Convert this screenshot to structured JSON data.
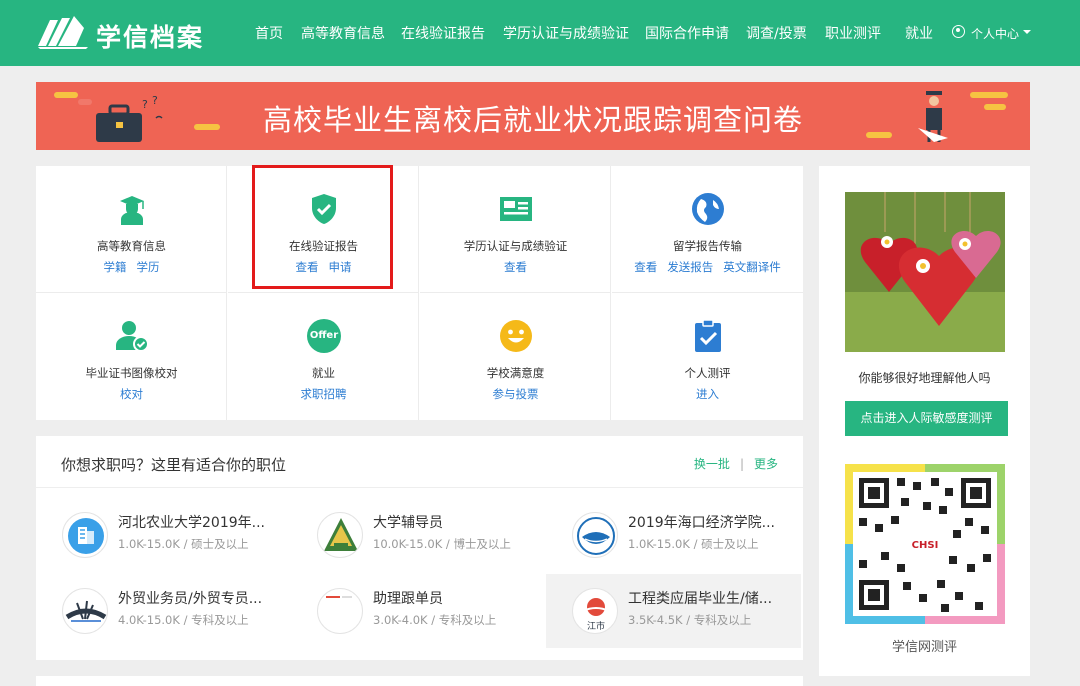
{
  "header": {
    "brand": "学信档案",
    "nav": [
      "首页",
      "高等教育信息",
      "在线验证报告",
      "学历认证与成绩验证",
      "国际合作申请",
      "调查/投票",
      "职业测评",
      "就业"
    ],
    "user_menu": "个人中心",
    "bg_color": "#27b581"
  },
  "banner": {
    "title": "高校毕业生离校后就业状况跟踪调查问卷",
    "bg_color": "#ef6454"
  },
  "services": [
    {
      "name": "高等教育信息",
      "links": [
        "学籍",
        "学历"
      ],
      "icon": "graduate-icon"
    },
    {
      "name": "在线验证报告",
      "links": [
        "查看",
        "申请"
      ],
      "icon": "shield-check-icon"
    },
    {
      "name": "学历认证与成绩验证",
      "links": [
        "查看"
      ],
      "icon": "id-card-icon"
    },
    {
      "name": "留学报告传输",
      "links": [
        "查看",
        "发送报告",
        "英文翻译件"
      ],
      "icon": "globe-icon"
    },
    {
      "name": "毕业证书图像校对",
      "links": [
        "校对"
      ],
      "icon": "user-check-icon"
    },
    {
      "name": "就业",
      "links": [
        "求职招聘"
      ],
      "icon": "offer-icon",
      "badge": "Offer"
    },
    {
      "name": "学校满意度",
      "links": [
        "参与投票"
      ],
      "icon": "smiley-icon"
    },
    {
      "name": "个人测评",
      "links": [
        "进入"
      ],
      "icon": "clipboard-check-icon"
    }
  ],
  "jobs": {
    "title": "你想求职吗？这里有适合你的职位",
    "refresh": "换一批",
    "more": "更多",
    "items": [
      {
        "title": "河北农业大学2019年...",
        "salary": "1.0K-15.0K",
        "degree": "硕士及以上"
      },
      {
        "title": "大学辅导员",
        "salary": "10.0K-15.0K",
        "degree": "博士及以上"
      },
      {
        "title": "2019年海口经济学院...",
        "salary": "1.0K-15.0K",
        "degree": "硕士及以上"
      },
      {
        "title": "外贸业务员/外贸专员...",
        "salary": "4.0K-15.0K",
        "degree": "专科及以上"
      },
      {
        "title": "助理跟单员",
        "salary": "3.0K-4.0K",
        "degree": "专科及以上"
      },
      {
        "title": "工程类应届毕业生/储...",
        "salary": "3.5K-4.5K",
        "degree": "专科及以上",
        "logo_text": "江市"
      }
    ]
  },
  "sidebar": {
    "caption": "你能够很好地理解他人吗",
    "button": "点击进入人际敏感度测评",
    "qr_label": "CHSI",
    "qr_caption": "学信网测评"
  }
}
